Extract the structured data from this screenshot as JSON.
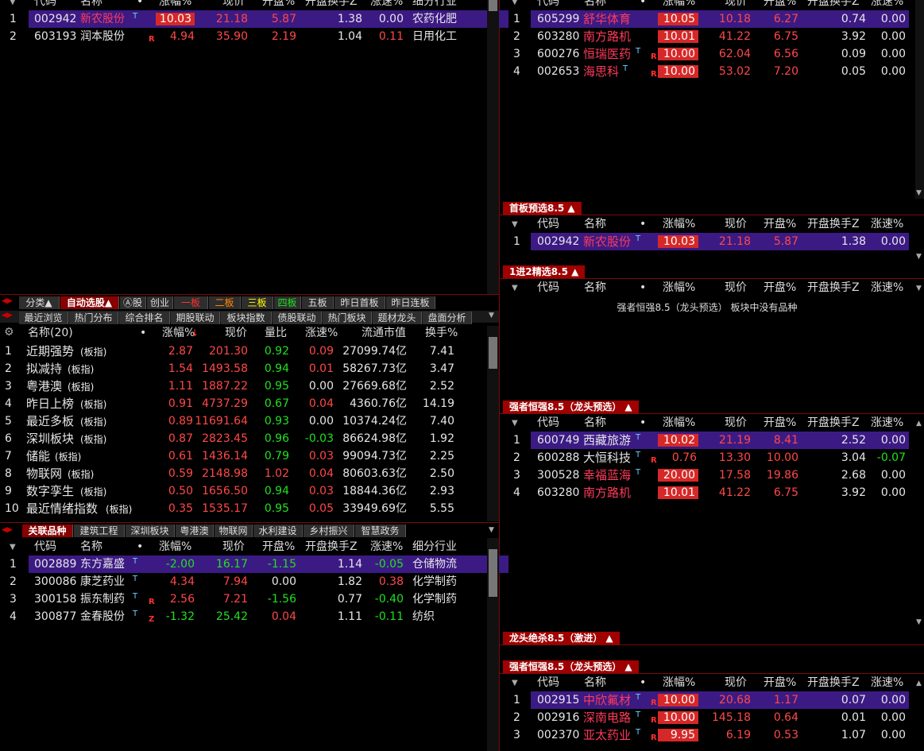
{
  "top_left": {
    "headers": [
      "代码",
      "名称",
      "•",
      "涨幅%",
      "现价",
      "开盘%",
      "开盘换手Z",
      "涨速%",
      "细分行业"
    ],
    "rows": [
      {
        "n": "1",
        "code": "002942",
        "name": "新农股份",
        "t": "T",
        "r": "",
        "pct": "10.03",
        "price": "21.18",
        "open": "5.87",
        "turn": "1.38",
        "speed": "0.00",
        "ind": "农药化肥"
      },
      {
        "n": "2",
        "code": "603193",
        "name": "润本股份",
        "t": "",
        "r": "R",
        "pct": "4.94",
        "price": "35.90",
        "open": "2.19",
        "turn": "1.04",
        "speed": "0.11",
        "ind": "日用化工"
      }
    ]
  },
  "tabs_row1": [
    "分类▲",
    "自动选股▲",
    "Ⓐ股",
    "创业",
    "一板",
    "二板",
    "三板",
    "四板",
    "五板",
    "昨日首板",
    "昨日连板"
  ],
  "tabs_row2": [
    "最近浏览",
    "热门分布",
    "综合排名",
    "期股联动",
    "板块指数",
    "债股联动",
    "热门板块",
    "题材龙头",
    "盘面分析"
  ],
  "sector": {
    "headers": [
      "名称(20)",
      "•",
      "涨幅%",
      "现价",
      "量比",
      "涨速%",
      "流通市值",
      "换手%"
    ],
    "rows": [
      {
        "n": "1",
        "name": "近期强势",
        "tag": "(板指)",
        "pct": "2.87",
        "price": "201.30",
        "vol": "0.92",
        "speed": "0.09",
        "cap": "27099.74亿",
        "turn": "7.41"
      },
      {
        "n": "2",
        "name": "拟减持",
        "tag": "(板指)",
        "pct": "1.54",
        "price": "1493.58",
        "vol": "0.94",
        "speed": "0.01",
        "cap": "58267.73亿",
        "turn": "3.47"
      },
      {
        "n": "3",
        "name": "粤港澳",
        "tag": "(板指)",
        "pct": "1.11",
        "price": "1887.22",
        "vol": "0.95",
        "speed": "0.00",
        "cap": "27669.68亿",
        "turn": "2.52"
      },
      {
        "n": "4",
        "name": "昨日上榜",
        "tag": "(板指)",
        "pct": "0.91",
        "price": "4737.29",
        "vol": "0.67",
        "speed": "0.04",
        "cap": "4360.76亿",
        "turn": "14.19"
      },
      {
        "n": "5",
        "name": "最近多板",
        "tag": "(板指)",
        "pct": "0.89",
        "price": "11691.64",
        "vol": "0.93",
        "speed": "0.00",
        "cap": "10374.24亿",
        "turn": "7.40"
      },
      {
        "n": "6",
        "name": "深圳板块",
        "tag": "(板指)",
        "pct": "0.87",
        "price": "2823.45",
        "vol": "0.96",
        "speed": "-0.03",
        "cap": "86624.98亿",
        "turn": "1.92"
      },
      {
        "n": "7",
        "name": "储能",
        "tag": "(板指)",
        "pct": "0.61",
        "price": "1436.14",
        "vol": "0.79",
        "speed": "0.03",
        "cap": "99094.73亿",
        "turn": "2.25"
      },
      {
        "n": "8",
        "name": "物联网",
        "tag": "(板指)",
        "pct": "0.59",
        "price": "2148.98",
        "vol": "1.02",
        "speed": "0.04",
        "cap": "80603.63亿",
        "turn": "2.50"
      },
      {
        "n": "9",
        "name": "数字孪生",
        "tag": "(板指)",
        "pct": "0.50",
        "price": "1656.50",
        "vol": "0.94",
        "speed": "0.03",
        "cap": "18844.36亿",
        "turn": "2.93"
      },
      {
        "n": "10",
        "name": "最近情绪指数",
        "tag": "(板指)",
        "pct": "0.35",
        "price": "1535.17",
        "vol": "0.95",
        "speed": "0.05",
        "cap": "33949.69亿",
        "turn": "5.55"
      }
    ]
  },
  "tabs_row3": [
    "关联品种",
    "建筑工程",
    "深圳板块",
    "粤港澳",
    "物联网",
    "水利建设",
    "乡村振兴",
    "智慧政务"
  ],
  "related": {
    "headers": [
      "代码",
      "名称",
      "•",
      "涨幅%",
      "现价",
      "开盘%",
      "开盘换手Z",
      "涨速%",
      "细分行业"
    ],
    "rows": [
      {
        "n": "1",
        "code": "002889",
        "name": "东方嘉盛",
        "t": "T",
        "r": "",
        "pct": "-2.00",
        "price": "16.17",
        "open": "-1.15",
        "turn": "1.14",
        "speed": "-0.05",
        "ind": "仓储物流"
      },
      {
        "n": "2",
        "code": "300086",
        "name": "康芝药业",
        "t": "T",
        "r": "",
        "pct": "4.34",
        "price": "7.94",
        "open": "0.00",
        "turn": "1.82",
        "speed": "0.38",
        "ind": "化学制药"
      },
      {
        "n": "3",
        "code": "300158",
        "name": "振东制药",
        "t": "T",
        "r": "R",
        "pct": "2.56",
        "price": "7.21",
        "open": "-1.56",
        "turn": "0.77",
        "speed": "-0.40",
        "ind": "化学制药"
      },
      {
        "n": "4",
        "code": "300877",
        "name": "金春股份",
        "t": "T",
        "r": "Z",
        "pct": "-1.32",
        "price": "25.42",
        "open": "0.04",
        "turn": "1.11",
        "speed": "-0.11",
        "ind": "纺织"
      }
    ]
  },
  "right_headers": [
    "代码",
    "名称",
    "•",
    "涨幅%",
    "现价",
    "开盘%",
    "开盘换手Z",
    "涨速%"
  ],
  "right_top": {
    "rows": [
      {
        "n": "1",
        "code": "605299",
        "name": "舒华体育",
        "t": "",
        "r": "",
        "pct": "10.05",
        "price": "10.18",
        "open": "6.27",
        "turn": "0.74",
        "speed": "0.00"
      },
      {
        "n": "2",
        "code": "603280",
        "name": "南方路机",
        "t": "",
        "r": "",
        "pct": "10.01",
        "price": "41.22",
        "open": "6.75",
        "turn": "3.92",
        "speed": "0.00"
      },
      {
        "n": "3",
        "code": "600276",
        "name": "恒瑞医药",
        "t": "T",
        "r": "R",
        "pct": "10.00",
        "price": "62.04",
        "open": "6.56",
        "turn": "0.09",
        "speed": "0.00"
      },
      {
        "n": "4",
        "code": "002653",
        "name": "海思科",
        "t": "T",
        "r": "R",
        "pct": "10.00",
        "price": "53.02",
        "open": "7.20",
        "turn": "0.05",
        "speed": "0.00"
      }
    ]
  },
  "sec_first": {
    "title": "首板预选8.5 ▲",
    "rows": [
      {
        "n": "1",
        "code": "002942",
        "name": "新农股份",
        "t": "T",
        "r": "",
        "pct": "10.03",
        "price": "21.18",
        "open": "5.87",
        "turn": "1.38",
        "speed": "0.00"
      }
    ]
  },
  "sec_jin2": {
    "title": "1进2精选8.5 ▲",
    "empty": "强者恒强8.5（龙头预选） 板块中没有品种"
  },
  "sec_strong": {
    "title": "强者恒强8.5（龙头预选） ▲",
    "rows": [
      {
        "n": "1",
        "code": "600749",
        "name": "西藏旅游",
        "t": "T",
        "r": "",
        "pct": "10.02",
        "price": "21.19",
        "open": "8.41",
        "turn": "2.52",
        "speed": "0.00"
      },
      {
        "n": "2",
        "code": "600288",
        "name": "大恒科技",
        "t": "T",
        "r": "R",
        "pct": "0.76",
        "price": "13.30",
        "open": "10.00",
        "turn": "3.04",
        "speed": "-0.07"
      },
      {
        "n": "3",
        "code": "300528",
        "name": "幸福蓝海",
        "t": "T",
        "r": "",
        "pct": "20.00",
        "price": "17.58",
        "open": "19.86",
        "turn": "2.68",
        "speed": "0.00"
      },
      {
        "n": "4",
        "code": "603280",
        "name": "南方路机",
        "t": "",
        "r": "",
        "pct": "10.01",
        "price": "41.22",
        "open": "6.75",
        "turn": "3.92",
        "speed": "0.00"
      }
    ]
  },
  "sec_dragon": {
    "title": "龙头绝杀8.5（激进） ▲"
  },
  "sec_strong2": {
    "title": "强者恒强8.5（龙头预选） ▲",
    "rows": [
      {
        "n": "1",
        "code": "002915",
        "name": "中欣氟材",
        "t": "T",
        "r": "R",
        "pct": "10.00",
        "price": "20.68",
        "open": "1.17",
        "turn": "0.07",
        "speed": "0.00"
      },
      {
        "n": "2",
        "code": "002916",
        "name": "深南电路",
        "t": "T",
        "r": "R",
        "pct": "10.00",
        "price": "145.18",
        "open": "0.64",
        "turn": "0.01",
        "speed": "0.00"
      },
      {
        "n": "3",
        "code": "002370",
        "name": "亚太药业",
        "t": "T",
        "r": "R",
        "pct": "9.95",
        "price": "6.19",
        "open": "0.53",
        "turn": "1.07",
        "speed": "0.00"
      }
    ]
  }
}
